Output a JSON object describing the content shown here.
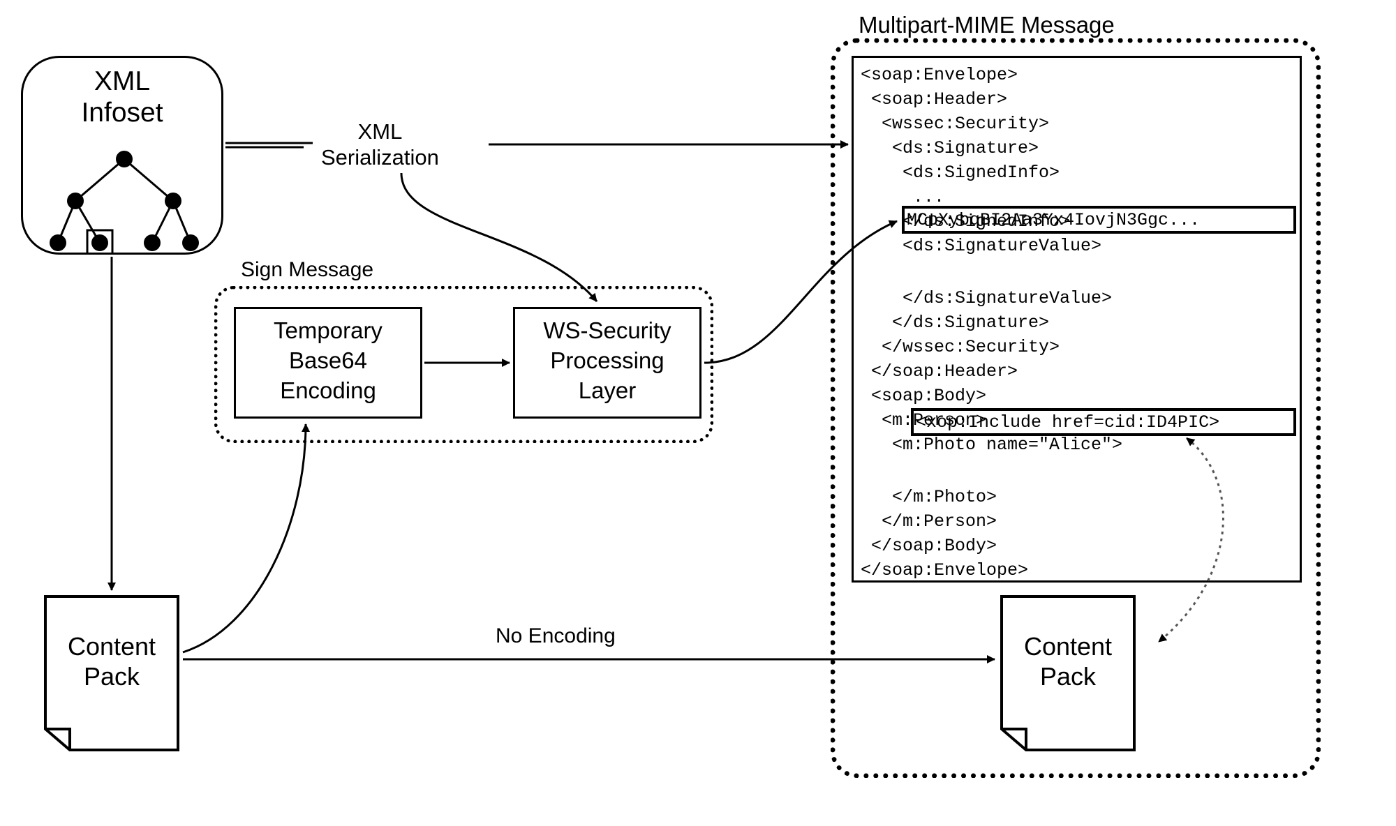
{
  "blocks": {
    "xml_infoset_title": "XML\nInfoset",
    "sign_message_label": "Sign Message",
    "temp_base64": "Temporary\nBase64\nEncoding",
    "ws_security": "WS-Security\nProcessing\nLayer",
    "mime_title": "Multipart-MIME Message",
    "content_pack_left": "Content\nPack",
    "content_pack_right": "Content\nPack"
  },
  "labels": {
    "xml_serialization": "XML\nSerialization",
    "no_encoding": "No Encoding"
  },
  "code": {
    "lines": [
      "<soap:Envelope>",
      " <soap:Header>",
      "  <wssec:Security>",
      "   <ds:Signature>",
      "    <ds:SignedInfo>",
      "     ...",
      "    </ds:SignedInfo>",
      "    <ds:SignatureValue>",
      "",
      "    </ds:SignatureValue>",
      "   </ds:Signature>",
      "  </wssec:Security>",
      " </soap:Header>",
      " <soap:Body>",
      "  <m:Person>",
      "   <m:Photo name=\"Alice\">",
      "",
      "   </m:Photo>",
      "  </m:Person>",
      " </soap:Body>",
      "</soap:Envelope>"
    ],
    "signature_value": "MCpXybqBI2Aa3Yx4IovjN3Ggc...",
    "xop_include": "<xop:Include href=cid:ID4PIC>"
  }
}
